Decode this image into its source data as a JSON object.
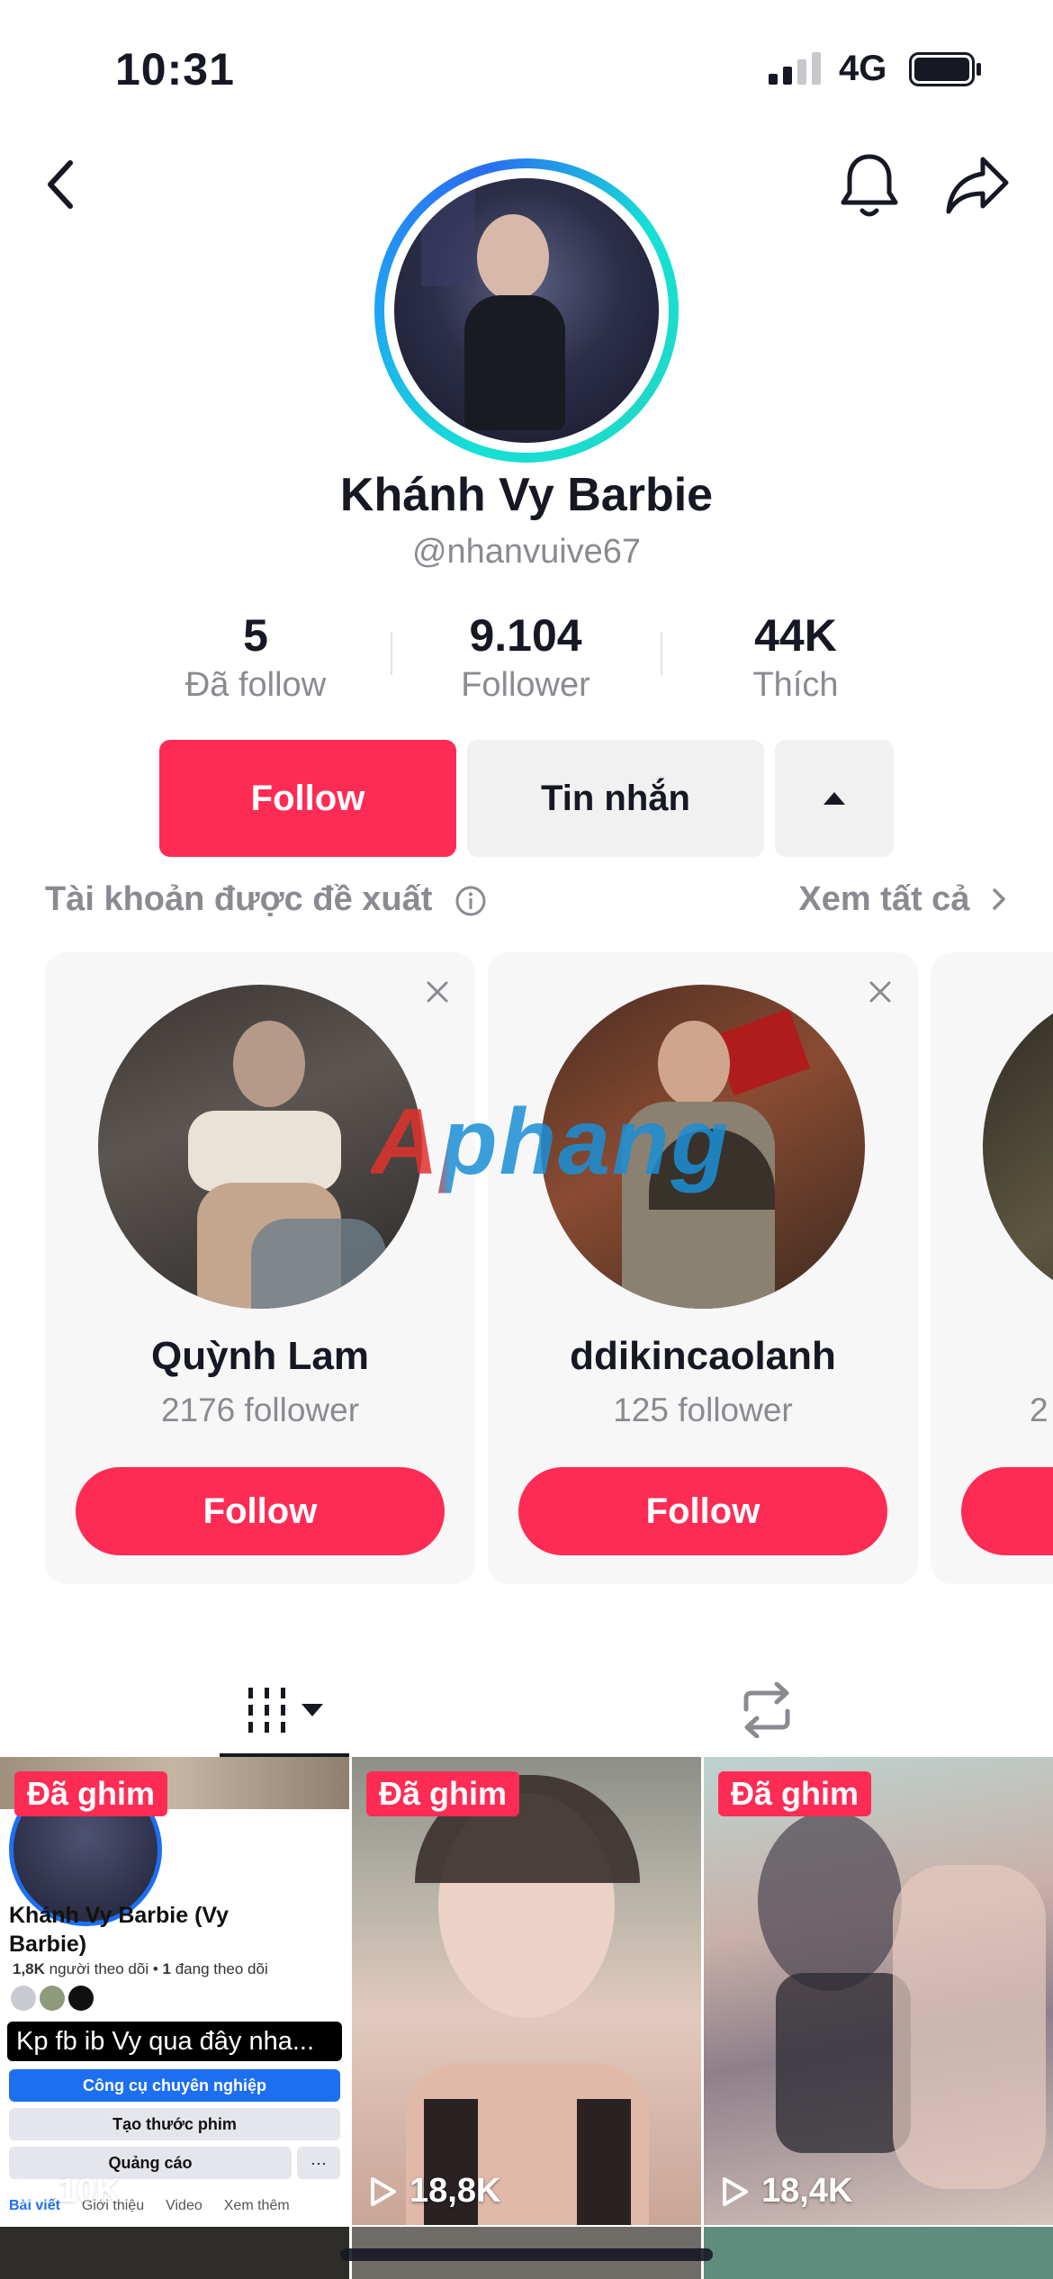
{
  "status_bar": {
    "time": "10:31",
    "network": "4G"
  },
  "profile": {
    "display_name": "Khánh Vy Barbie",
    "username": "@nhanvuive67",
    "stats": [
      {
        "value": "5",
        "label": "Đã follow"
      },
      {
        "value": "9.104",
        "label": "Follower"
      },
      {
        "value": "44K",
        "label": "Thích"
      }
    ],
    "follow_label": "Follow",
    "message_label": "Tin nhắn"
  },
  "suggested": {
    "title": "Tài khoản được đề xuất",
    "see_all": "Xem tất cả",
    "cards": [
      {
        "name": "Quỳnh Lam",
        "followers": "2176 follower",
        "button": "Follow"
      },
      {
        "name": "ddikincaolanh",
        "followers": "125 follower",
        "button": "Follow"
      },
      {
        "name": "",
        "followers": "2",
        "button": ""
      }
    ]
  },
  "watermark": "Aphang",
  "videos": [
    {
      "pinned": "Đã ghim",
      "views": "10K",
      "fb": {
        "name": "Khánh Vy Barbie (Vy Barbie)",
        "stats_followers": "1,8K",
        "stats_followers_label": "người theo dõi",
        "stats_following": "1",
        "stats_following_label": "đang theo dõi",
        "caption": "Kp fb ib Vy qua đây nha...",
        "btn1": "Công cụ chuyên nghiệp",
        "btn2": "Tạo thước phim",
        "btn3": "Quảng cáo",
        "btn4": "···",
        "tabs": [
          "Bài viết",
          "Giới thiệu",
          "Video",
          "Xem thêm"
        ]
      }
    },
    {
      "pinned": "Đã ghim",
      "views": "18,8K"
    },
    {
      "pinned": "Đã ghim",
      "views": "18,4K"
    }
  ],
  "colors": {
    "accent": "#fe2c55",
    "muted": "#8a8b91",
    "ring_start": "#1fa3f5",
    "ring_end": "#16e0d5"
  },
  "icons": [
    "back-icon",
    "bell-icon",
    "share-icon",
    "caret-up-icon",
    "info-icon",
    "chevron-right-icon",
    "close-icon",
    "grid-icon",
    "caret-down-icon",
    "repost-icon",
    "play-icon"
  ]
}
